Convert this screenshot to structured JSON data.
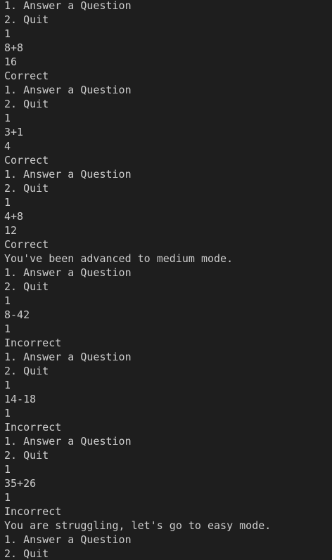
{
  "terminal": {
    "lines": [
      "1. Answer a Question",
      "2. Quit",
      "1",
      "8+8",
      "16",
      "Correct",
      "1. Answer a Question",
      "2. Quit",
      "1",
      "3+1",
      "4",
      "Correct",
      "1. Answer a Question",
      "2. Quit",
      "1",
      "4+8",
      "12",
      "Correct",
      "You've been advanced to medium mode.",
      "1. Answer a Question",
      "2. Quit",
      "1",
      "8-42",
      "1",
      "Incorrect",
      "1. Answer a Question",
      "2. Quit",
      "1",
      "14-18",
      "1",
      "Incorrect",
      "1. Answer a Question",
      "2. Quit",
      "1",
      "35+26",
      "1",
      "Incorrect",
      "You are struggling, let's go to easy mode.",
      "1. Answer a Question",
      "2. Quit"
    ]
  }
}
